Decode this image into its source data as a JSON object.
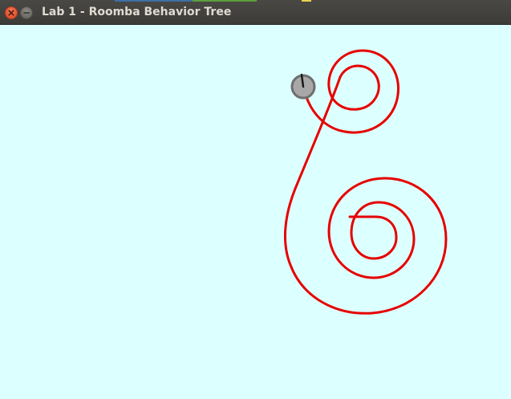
{
  "window": {
    "title": "Lab 1 - Roomba Behavior Tree",
    "close_icon": "close-icon",
    "minimize_icon": "minimize-icon"
  },
  "colors": {
    "titlebar": "#3c3b37",
    "title_text": "#dfdbd2",
    "canvas_background": "#dcffff",
    "path_color": "#e60000",
    "robot_body": "#a8a8a8",
    "robot_outline": "#6e6e6e",
    "heading_line": "#1a1a1a"
  }
}
